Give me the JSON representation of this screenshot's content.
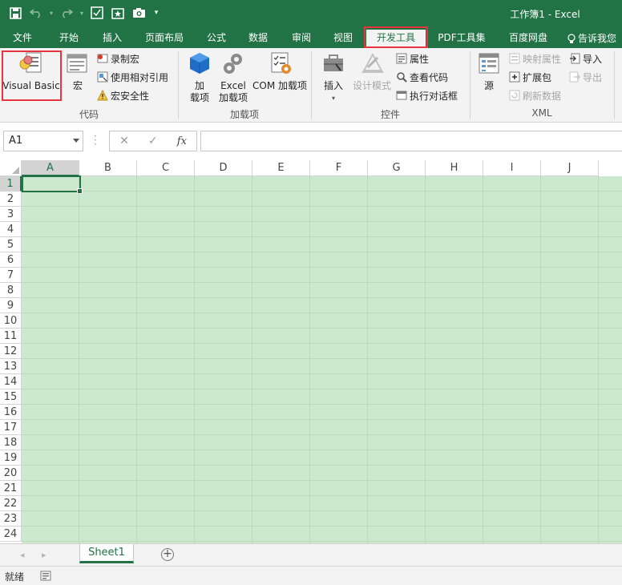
{
  "window": {
    "title": "工作簿1 - Excel"
  },
  "tabs": [
    "文件",
    "开始",
    "插入",
    "页面布局",
    "公式",
    "数据",
    "审阅",
    "视图",
    "开发工具",
    "PDF工具集",
    "百度网盘"
  ],
  "active_tab": "开发工具",
  "tell_me": "告诉我您",
  "ribbon": {
    "code": {
      "label": "代码",
      "visual_basic": "Visual Basic",
      "macros": "宏",
      "record_macro": "录制宏",
      "relative_refs": "使用相对引用",
      "macro_security": "宏安全性"
    },
    "addins": {
      "label": "加载项",
      "addins_line1": "加",
      "addins_line2": "载项",
      "excel_addins_line1": "Excel",
      "excel_addins_line2": "加载项",
      "com_addins": "COM 加载项"
    },
    "controls": {
      "label": "控件",
      "insert": "插入",
      "design_mode": "设计模式",
      "properties": "属性",
      "view_code": "查看代码",
      "run_dialog": "执行对话框"
    },
    "xml": {
      "label": "XML",
      "source": "源",
      "map_properties": "映射属性",
      "expansion_packs": "扩展包",
      "refresh_data": "刷新数据",
      "import": "导入",
      "export": "导出"
    }
  },
  "formula_bar": {
    "name_box": "A1",
    "cancel": "✕",
    "enter": "✓",
    "fx": "fx",
    "formula": ""
  },
  "columns": [
    "A",
    "B",
    "C",
    "D",
    "E",
    "F",
    "G",
    "H",
    "I",
    "J"
  ],
  "rows": [
    "1",
    "2",
    "3",
    "4",
    "5",
    "6",
    "7",
    "8",
    "9",
    "10",
    "11",
    "12",
    "13",
    "14",
    "15",
    "16",
    "17",
    "18",
    "19",
    "20",
    "21",
    "22",
    "23",
    "24"
  ],
  "selected_cell": "A1",
  "sheets": [
    "Sheet1"
  ],
  "status": {
    "ready": "就绪"
  },
  "colors": {
    "excel_green": "#217346",
    "highlight_red": "#e8343c",
    "grid_fill": "#cce8cf"
  }
}
